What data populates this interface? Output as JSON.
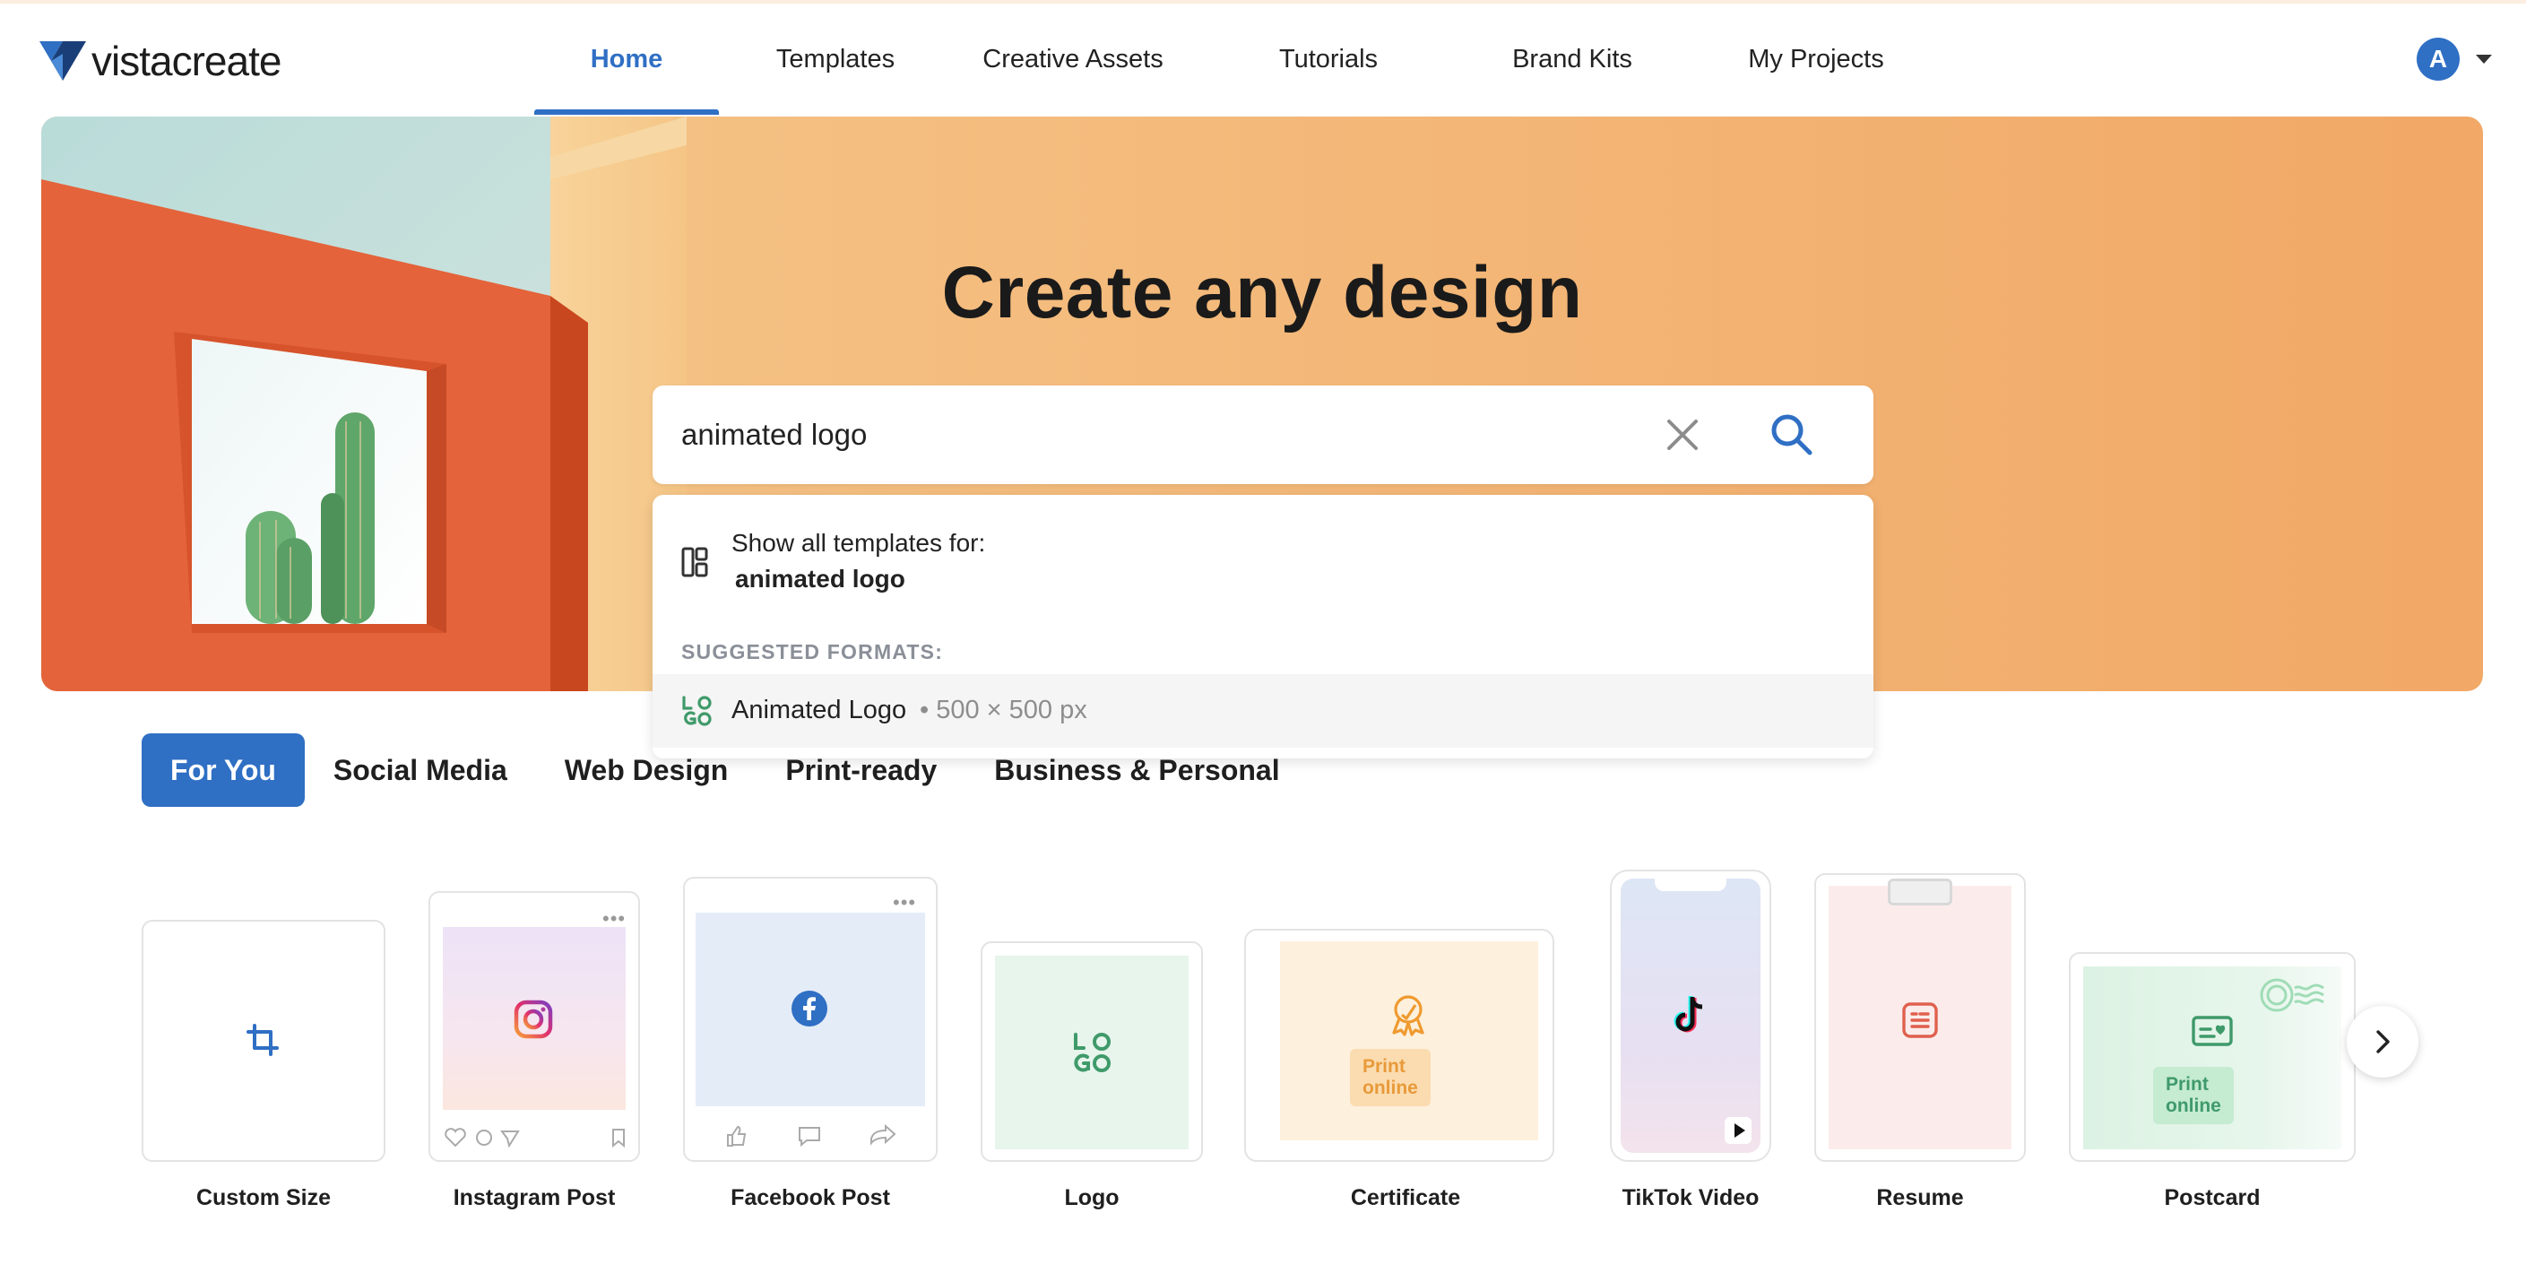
{
  "header": {
    "logo_text": "vistacreate",
    "logo_mark": "tm",
    "nav": [
      {
        "label": "Home",
        "active": true
      },
      {
        "label": "Templates",
        "active": false
      },
      {
        "label": "Creative Assets",
        "active": false
      },
      {
        "label": "Tutorials",
        "active": false
      },
      {
        "label": "Brand Kits",
        "active": false
      },
      {
        "label": "My Projects",
        "active": false
      }
    ],
    "avatar_initial": "A"
  },
  "hero": {
    "title": "Create any design"
  },
  "search": {
    "value": "animated logo",
    "clear_icon": "close-icon",
    "search_icon": "search-icon"
  },
  "dropdown": {
    "show_all_label": "Show all templates for:",
    "show_all_query": "animated logo",
    "suggested_heading": "SUGGESTED FORMATS:",
    "formats": [
      {
        "name": "Animated Logo",
        "size": "• 500 × 500 px"
      }
    ]
  },
  "categories": [
    {
      "label": "For You",
      "active": true
    },
    {
      "label": "Social Media",
      "active": false
    },
    {
      "label": "Web Design",
      "active": false
    },
    {
      "label": "Print-ready",
      "active": false
    },
    {
      "label": "Business & Personal",
      "active": false
    }
  ],
  "formats": [
    {
      "label": "Custom Size",
      "icon": "crop-icon"
    },
    {
      "label": "Instagram Post",
      "icon": "instagram-icon"
    },
    {
      "label": "Facebook Post",
      "icon": "facebook-icon"
    },
    {
      "label": "Logo",
      "icon": "logo-icon",
      "icon_text": "LOGO"
    },
    {
      "label": "Certificate",
      "icon": "award-icon",
      "badge": "Print online"
    },
    {
      "label": "TikTok Video",
      "icon": "tiktok-icon"
    },
    {
      "label": "Resume",
      "icon": "document-icon"
    },
    {
      "label": "Postcard",
      "icon": "postcard-icon",
      "badge": "Print online"
    }
  ],
  "colors": {
    "accent": "#2f6fc4",
    "hero_orange": "#f2a866",
    "hero_wall": "#e2582f"
  }
}
